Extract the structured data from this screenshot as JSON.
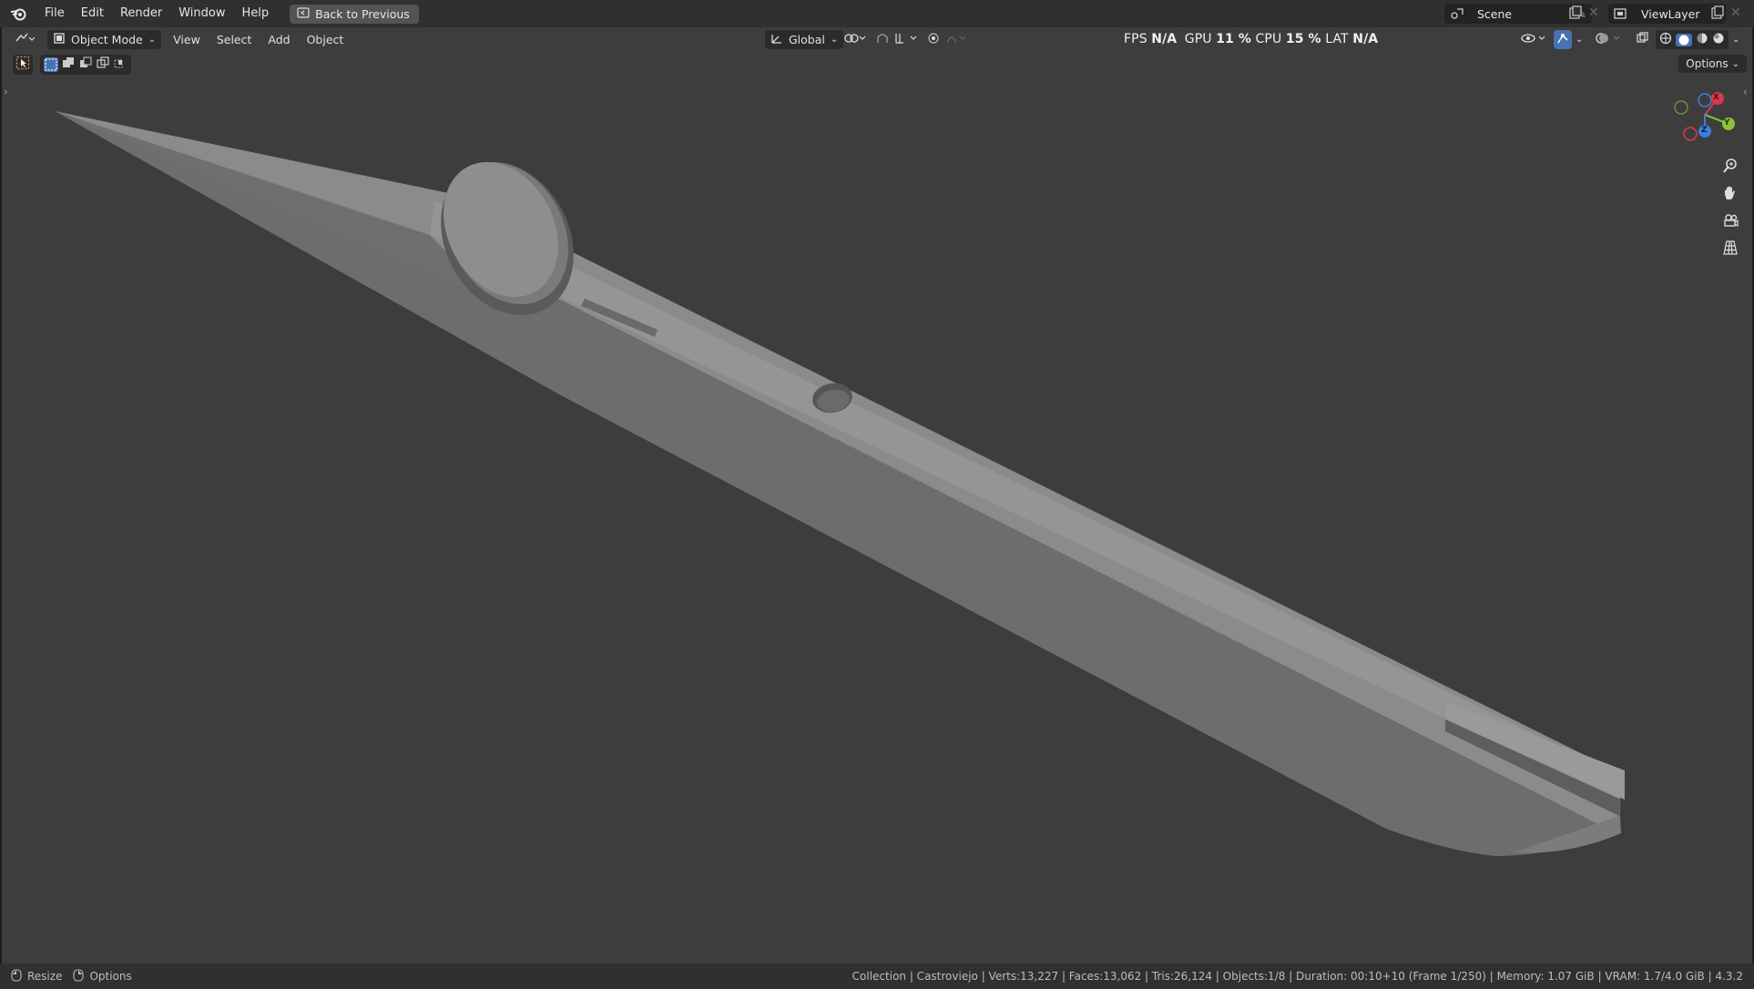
{
  "topbar": {
    "menus": [
      "File",
      "Edit",
      "Render",
      "Window",
      "Help"
    ],
    "back_button": "Back to Previous",
    "scene_name": "Scene",
    "view_layer": "ViewLayer"
  },
  "viewport_header": {
    "mode": "Object Mode",
    "menus": [
      "View",
      "Select",
      "Add",
      "Object"
    ],
    "transform_orientation": "Global",
    "options_label": "Options"
  },
  "stats_overlay": {
    "fps_label": "FPS",
    "fps_value": "N/A",
    "gpu_label": "GPU",
    "gpu_value": "11 %",
    "cpu_label": "CPU",
    "cpu_value": "15 %",
    "lat_label": "LAT",
    "lat_value": "N/A"
  },
  "gizmo": {
    "x_label": "X",
    "y_label": "Y",
    "z_label": "Z",
    "x_color": "#e0364d",
    "y_color": "#8bc23a",
    "z_color": "#3a7fe0"
  },
  "statusbar": {
    "left_items": [
      "Resize",
      "Options"
    ],
    "info": "Collection | Castroviejo | Verts:13,227 | Faces:13,062 | Tris:26,124 | Objects:1/8 | Duration: 00:10+10 (Frame 1/250) | Memory: 1.07 GiB | VRAM: 1.7/4.0 GiB | 4.3.2"
  },
  "icons": {
    "blender": "blender-logo-icon",
    "back": "back-to-previous-icon",
    "scene": "scene-icon",
    "view_layer": "view-layer-icon",
    "editor_type": "editor-type-icon",
    "object_mode": "object-mode-icon",
    "transform": "transform-orientation-icon",
    "pivot": "pivot-point-icon",
    "snap": "snap-icon",
    "proportional": "proportional-editing-icon",
    "visibility": "visibility-icon",
    "gizmo_toggle": "gizmo-toggle-icon",
    "overlay": "overlay-icon",
    "xray": "xray-icon",
    "shading": "viewport-shading-icon",
    "zoom": "zoom-icon",
    "pan": "pan-hand-icon",
    "camera": "camera-view-icon",
    "grid": "ortho-grid-icon"
  }
}
